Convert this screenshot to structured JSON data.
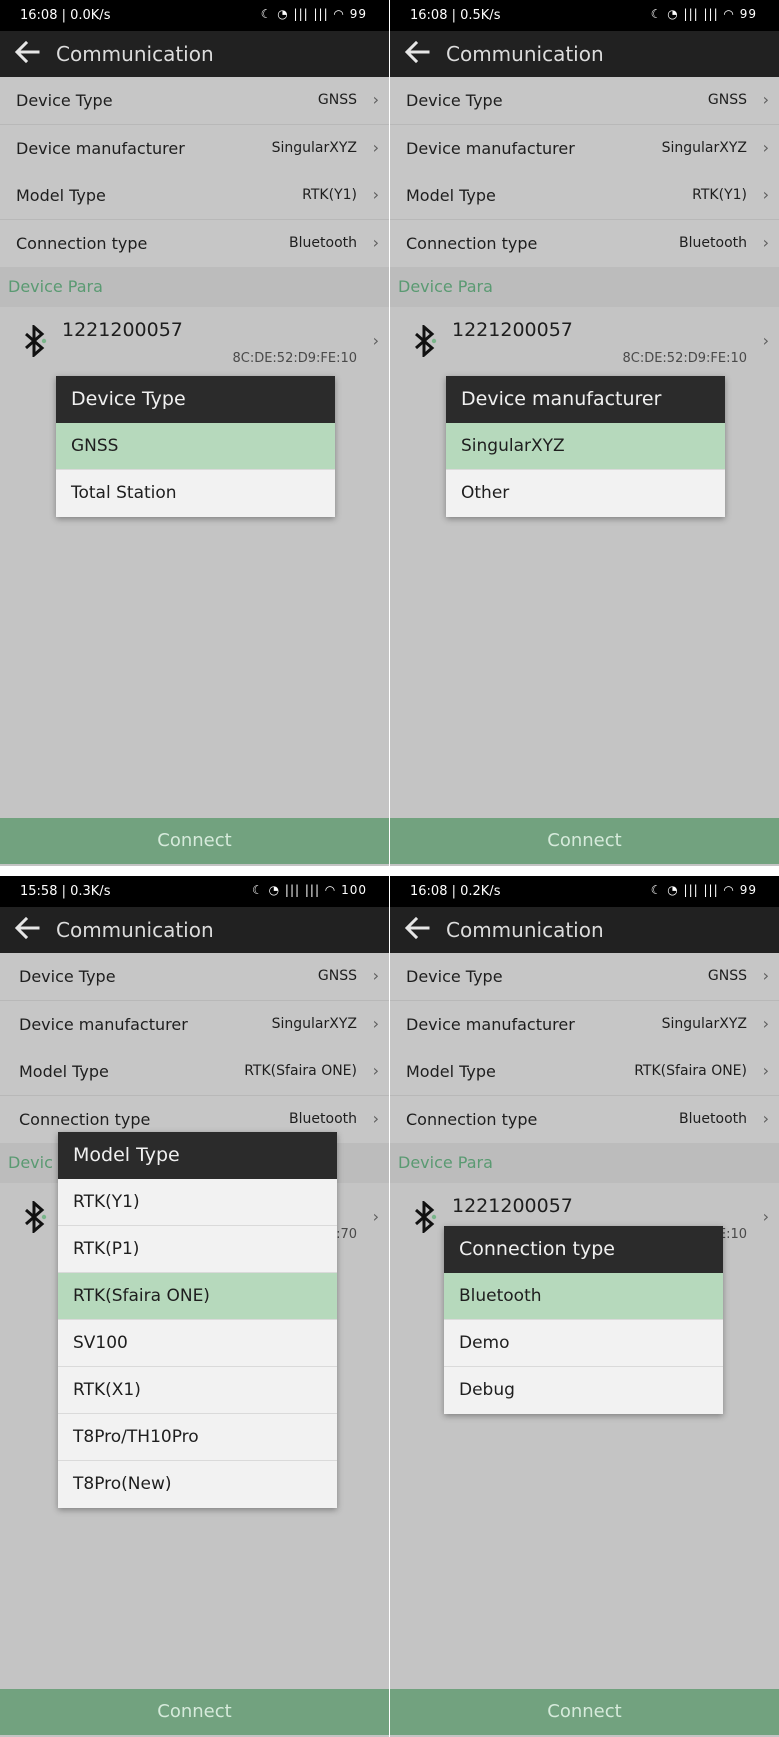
{
  "panels": [
    {
      "status": {
        "time": "16:08 | 0.0K/s",
        "icons": "☾ ◔  |||  |||  ◠  99"
      },
      "appbar": {
        "title": "Communication"
      },
      "rows": [
        {
          "label": "Device Type",
          "value": "GNSS"
        },
        {
          "label": "Device manufacturer",
          "value": "SingularXYZ"
        },
        {
          "label": "Model Type",
          "value": "RTK(Y1)"
        },
        {
          "label": "Connection type",
          "value": "Bluetooth"
        }
      ],
      "section_title": "Device Para",
      "device": {
        "number": "1221200057",
        "mac": "8C:DE:52:D9:FE:10"
      },
      "connect_label": "Connect",
      "dialog": {
        "title": "Device Type",
        "options": [
          "GNSS",
          "Total Station"
        ],
        "selected": 0
      }
    },
    {
      "status": {
        "time": "16:08 | 0.5K/s",
        "icons": "☾ ◔  |||  |||  ◠  99"
      },
      "appbar": {
        "title": "Communication"
      },
      "rows": [
        {
          "label": "Device Type",
          "value": "GNSS"
        },
        {
          "label": "Device manufacturer",
          "value": "SingularXYZ"
        },
        {
          "label": "Model Type",
          "value": "RTK(Y1)"
        },
        {
          "label": "Connection type",
          "value": "Bluetooth"
        }
      ],
      "section_title": "Device Para",
      "device": {
        "number": "1221200057",
        "mac": "8C:DE:52:D9:FE:10"
      },
      "connect_label": "Connect",
      "dialog": {
        "title": "Device manufacturer",
        "options": [
          "SingularXYZ",
          "Other"
        ],
        "selected": 0
      }
    },
    {
      "status": {
        "time": "15:58 | 0.3K/s",
        "icons": "☾ ◔  |||  |||  ◠  100"
      },
      "appbar": {
        "title": "Communication"
      },
      "rows": [
        {
          "label": "Device Type",
          "value": "GNSS"
        },
        {
          "label": "Device manufacturer",
          "value": "SingularXYZ"
        },
        {
          "label": "Model Type",
          "value": "RTK(Sfaira ONE)"
        },
        {
          "label": "Connection type",
          "value": "Bluetooth"
        }
      ],
      "section_title": "Devic",
      "device": {
        "number": "",
        "mac": ":70"
      },
      "connect_label": "Connect",
      "dialog": {
        "title": "Model Type",
        "options": [
          "RTK(Y1)",
          "RTK(P1)",
          "RTK(Sfaira ONE)",
          "SV100",
          "RTK(X1)",
          "T8Pro/TH10Pro",
          "T8Pro(New)"
        ],
        "selected": 2
      }
    },
    {
      "status": {
        "time": "16:08 | 0.2K/s",
        "icons": "☾ ◔  |||  |||  ◠  99"
      },
      "appbar": {
        "title": "Communication"
      },
      "rows": [
        {
          "label": "Device Type",
          "value": "GNSS"
        },
        {
          "label": "Device manufacturer",
          "value": "SingularXYZ"
        },
        {
          "label": "Model Type",
          "value": "RTK(Sfaira ONE)"
        },
        {
          "label": "Connection type",
          "value": "Bluetooth"
        }
      ],
      "section_title": "Device Para",
      "device": {
        "number": "1221200057",
        "mac": "E:10"
      },
      "connect_label": "Connect",
      "dialog": {
        "title": "Connection type",
        "options": [
          "Bluetooth",
          "Demo",
          "Debug"
        ],
        "selected": 0
      }
    }
  ]
}
